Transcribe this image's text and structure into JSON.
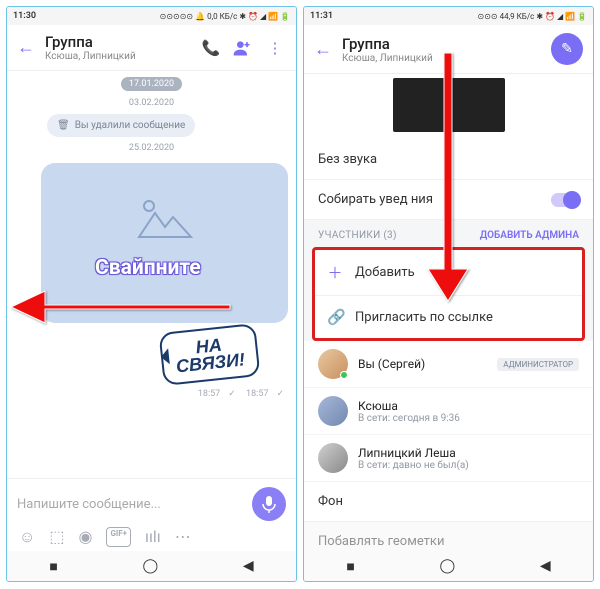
{
  "left": {
    "status": {
      "time": "11:30",
      "net": "0,0 КБ/с"
    },
    "header": {
      "title": "Группа",
      "subtitle": "Ксюша, Липницкий"
    },
    "date_pill": "17.01.2020",
    "date1": "03.02.2020",
    "deleted": "Вы удалили сообщение",
    "date2": "25.02.2020",
    "swipe": "Свайпните",
    "na_svyazi_l1": "НА",
    "na_svyazi_l2": "СВЯЗИ!",
    "time1": "18:57",
    "time2": "18:57",
    "input_placeholder": "Напишите сообщение...",
    "gif": "GIF+"
  },
  "right": {
    "status": {
      "time": "11:31",
      "net": "44,9 КБ/с"
    },
    "header": {
      "title": "Группа",
      "subtitle": "Ксюша, Липницкий"
    },
    "mute": "Без звука",
    "collect": "Собирать увед           ния",
    "participants": "УЧАСТНИКИ (3)",
    "add_admin": "ДОБАВИТЬ АДМИНА",
    "add": "Добавить",
    "invite": "Пригласить по ссылке",
    "m1_name": "Вы (Сергей)",
    "m1_badge": "АДМИНИСТРАТОР",
    "m2_name": "Ксюша",
    "m2_status": "В сети: сегодня в 9:36",
    "m3_name": "Липницкий Леша",
    "m3_status": "В сети: давно не был(а)",
    "background": "Фон",
    "geo": "Побавлять геометки"
  }
}
